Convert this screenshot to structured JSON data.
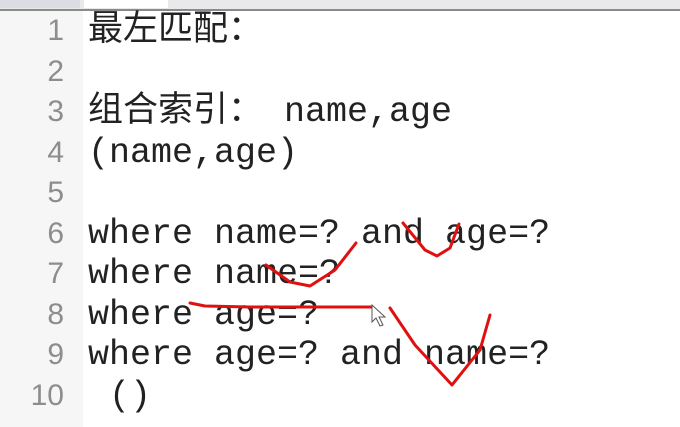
{
  "editor": {
    "lines": [
      {
        "number": "1",
        "text": "最左匹配："
      },
      {
        "number": "2",
        "text": ""
      },
      {
        "number": "3",
        "text": "组合索引： name,age"
      },
      {
        "number": "4",
        "text": "(name,age)"
      },
      {
        "number": "5",
        "text": ""
      },
      {
        "number": "6",
        "text": "where name=? and age=?"
      },
      {
        "number": "7",
        "text": "where name=?"
      },
      {
        "number": "8",
        "text": "where age=?"
      },
      {
        "number": "9",
        "text": "where age=? and name=?"
      },
      {
        "number": "10",
        "text": " ()"
      }
    ]
  },
  "annotation_color": "#e01010"
}
